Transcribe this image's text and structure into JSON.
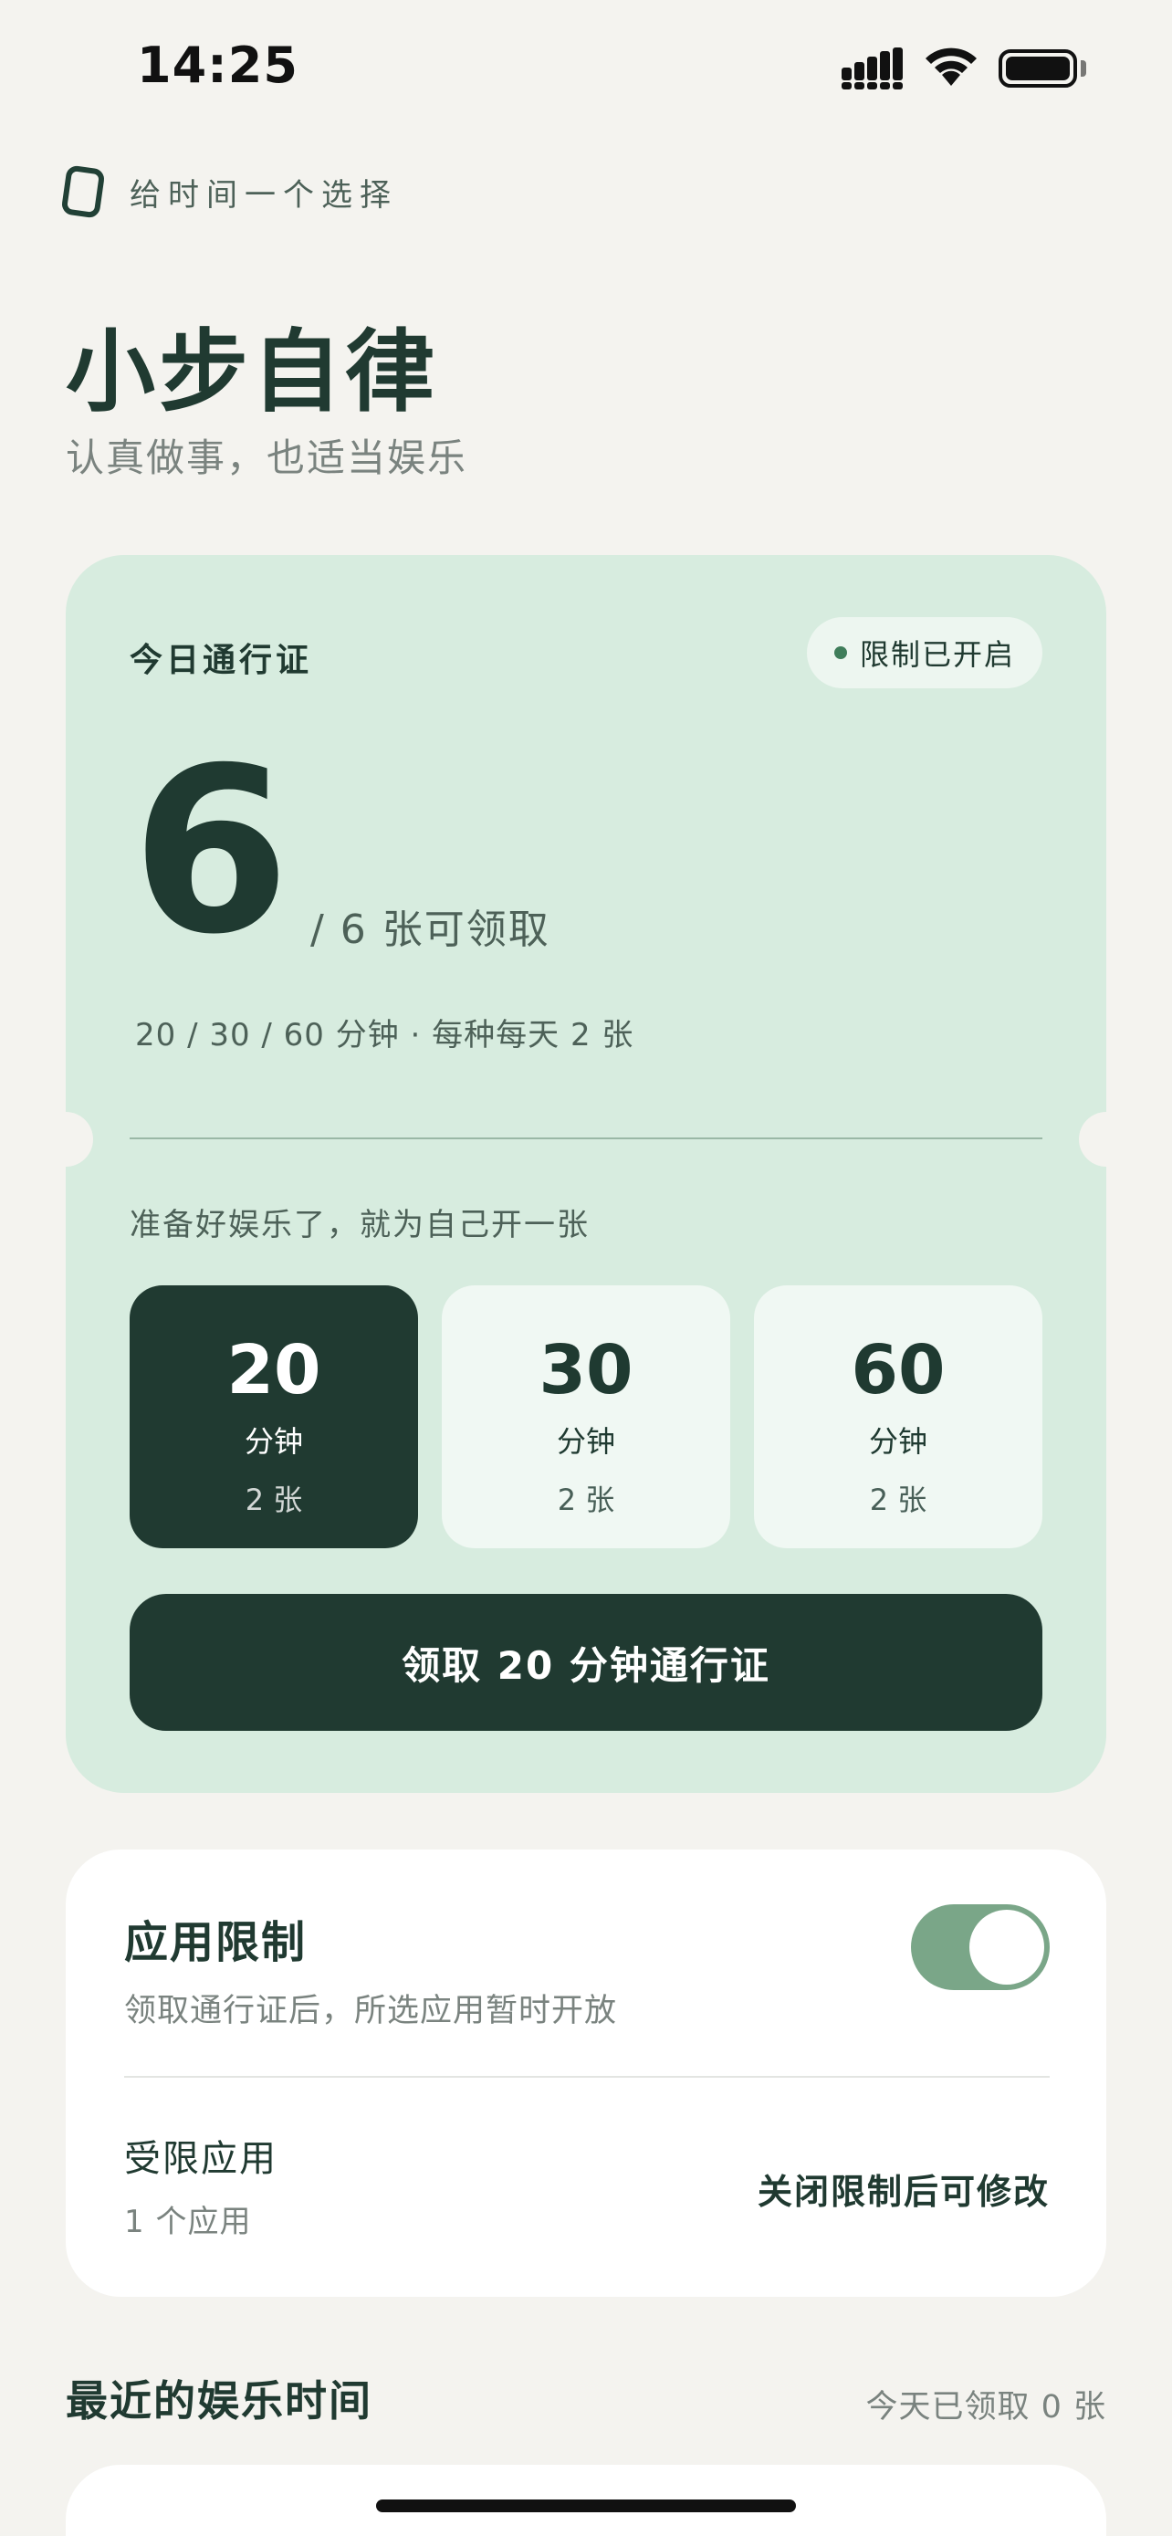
{
  "status_bar": {
    "time": "14:25"
  },
  "header": {
    "tagline": "给时间一个选择",
    "title": "小步自律",
    "subtitle": "认真做事，也适当娱乐"
  },
  "pass_card": {
    "title": "今日通行证",
    "badge": "限制已开启",
    "available_count": "6",
    "count_suffix": "/ 6 张可领取",
    "rule": "20 / 30 / 60 分钟 · 每种每天 2 张",
    "prompt": "准备好娱乐了，就为自己开一张",
    "options": [
      {
        "minutes": "20",
        "unit": "分钟",
        "count": "2 张",
        "selected": true
      },
      {
        "minutes": "30",
        "unit": "分钟",
        "count": "2 张",
        "selected": false
      },
      {
        "minutes": "60",
        "unit": "分钟",
        "count": "2 张",
        "selected": false
      }
    ],
    "claim_button": "领取 20 分钟通行证"
  },
  "app_limit": {
    "title": "应用限制",
    "description": "领取通行证后，所选应用暂时开放",
    "toggle_on": true,
    "restricted_label": "受限应用",
    "restricted_count": "1 个应用",
    "restricted_note": "关闭限制后可修改"
  },
  "recent": {
    "title": "最近的娱乐时间",
    "meta": "今天已领取 0 张"
  },
  "colors": {
    "background": "#f4f3ef",
    "accent_dark": "#203a31",
    "card_green": "#d7ecdf",
    "toggle_green": "#7aa688"
  },
  "icons": [
    "signal-icon",
    "wifi-icon",
    "battery-icon",
    "logo-icon"
  ]
}
